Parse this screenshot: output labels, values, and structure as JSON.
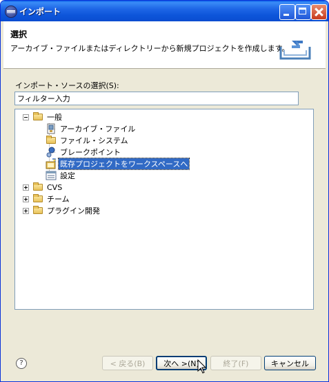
{
  "window": {
    "title": "インポート"
  },
  "banner": {
    "title": "選択",
    "description": "アーカイブ・ファイルまたはディレクトリーから新規プロジェクトを作成します。"
  },
  "source": {
    "label": "インポート・ソースの選択(S):",
    "filter_value": "フィルター入力"
  },
  "tree": {
    "items": [
      {
        "label": "一般",
        "icon": "folder-open-icon",
        "expanded": true
      },
      {
        "label": "アーカイブ・ファイル",
        "icon": "archive-file-icon"
      },
      {
        "label": "ファイル・システム",
        "icon": "folder-icon"
      },
      {
        "label": "ブレークポイント",
        "icon": "breakpoint-icon"
      },
      {
        "label": "既存プロジェクトをワークスペースへ",
        "icon": "project-import-icon",
        "selected": true
      },
      {
        "label": "設定",
        "icon": "preferences-icon"
      },
      {
        "label": "CVS",
        "icon": "folder-icon",
        "expanded": false
      },
      {
        "label": "チーム",
        "icon": "folder-icon",
        "expanded": false
      },
      {
        "label": "プラグイン開発",
        "icon": "folder-icon",
        "expanded": false
      }
    ]
  },
  "buttons": {
    "help": "?",
    "back": "< 戻る(B)",
    "next": "次へ >(N)",
    "finish": "終了(F)",
    "cancel": "キャンセル"
  },
  "colors": {
    "titlebar": "#0a55da",
    "selection": "#316ac5",
    "dialog_bg": "#ece9d8"
  }
}
